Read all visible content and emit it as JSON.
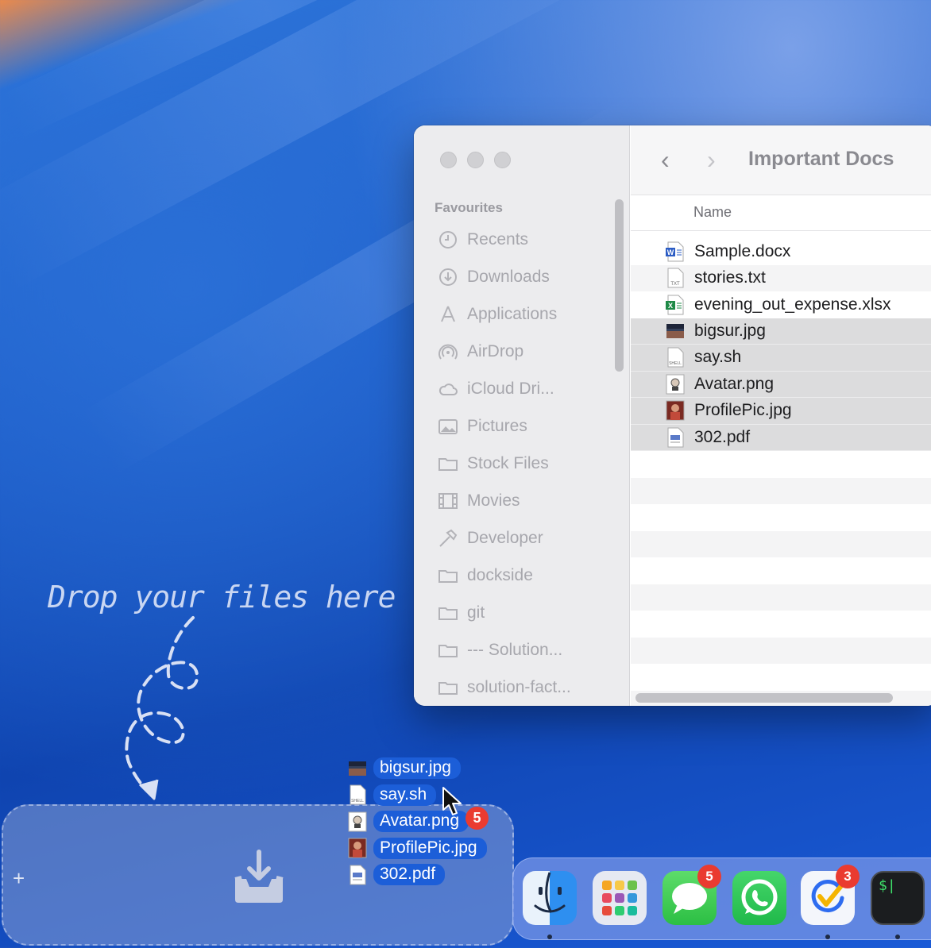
{
  "wallpaper": {
    "accent": "#1a58c6"
  },
  "finder": {
    "title": "Important Docs",
    "back_icon": "chevron-left-icon",
    "forward_icon": "chevron-right-icon",
    "sidebar": {
      "section": "Favourites",
      "items": [
        {
          "label": "Recents",
          "icon": "clock-icon"
        },
        {
          "label": "Downloads",
          "icon": "download-circle-icon"
        },
        {
          "label": "Applications",
          "icon": "applications-icon"
        },
        {
          "label": "AirDrop",
          "icon": "airdrop-icon"
        },
        {
          "label": "iCloud Dri...",
          "icon": "cloud-icon"
        },
        {
          "label": "Pictures",
          "icon": "picture-icon"
        },
        {
          "label": "Stock Files",
          "icon": "folder-icon"
        },
        {
          "label": "Movies",
          "icon": "film-icon"
        },
        {
          "label": "Developer",
          "icon": "hammer-icon"
        },
        {
          "label": "dockside",
          "icon": "folder-icon"
        },
        {
          "label": "git",
          "icon": "folder-icon"
        },
        {
          "label": "--- Solution...",
          "icon": "folder-icon"
        },
        {
          "label": "solution-fact...",
          "icon": "folder-icon"
        }
      ]
    },
    "column_header": "Name",
    "files": [
      {
        "name": "Sample.docx",
        "icon": "word-doc-icon",
        "selected": false
      },
      {
        "name": "stories.txt",
        "icon": "text-file-icon",
        "selected": false
      },
      {
        "name": "evening_out_expense.xlsx",
        "icon": "excel-icon",
        "selected": false
      },
      {
        "name": "bigsur.jpg",
        "icon": "image-thumbnail-icon",
        "selected": true
      },
      {
        "name": "say.sh",
        "icon": "shell-script-icon",
        "selected": true
      },
      {
        "name": "Avatar.png",
        "icon": "avatar-thumbnail-icon",
        "selected": true
      },
      {
        "name": "ProfilePic.jpg",
        "icon": "photo-thumbnail-icon",
        "selected": true
      },
      {
        "name": "302.pdf",
        "icon": "pdf-icon",
        "selected": true
      }
    ]
  },
  "drop_hint": "Drop your files here",
  "dropzone": {
    "add_label": "+",
    "icon": "tray-download-icon"
  },
  "drag": {
    "files": [
      "bigsur.jpg",
      "say.sh",
      "Avatar.png",
      "ProfilePic.jpg",
      "302.pdf"
    ],
    "count_badge": "5"
  },
  "dock": {
    "apps": [
      {
        "name": "Finder",
        "icon": "finder-icon",
        "badge": "",
        "running": true
      },
      {
        "name": "Launchpad",
        "icon": "launchpad-icon",
        "badge": "",
        "running": false
      },
      {
        "name": "Messages",
        "icon": "messages-icon",
        "badge": "5",
        "running": false
      },
      {
        "name": "WhatsApp",
        "icon": "whatsapp-icon",
        "badge": "",
        "running": false
      },
      {
        "name": "Tasks",
        "icon": "checkmark-app-icon",
        "badge": "3",
        "running": true
      },
      {
        "name": "Terminal",
        "icon": "terminal-icon",
        "badge": "",
        "running": true
      }
    ],
    "terminal_prompt": "$|"
  }
}
